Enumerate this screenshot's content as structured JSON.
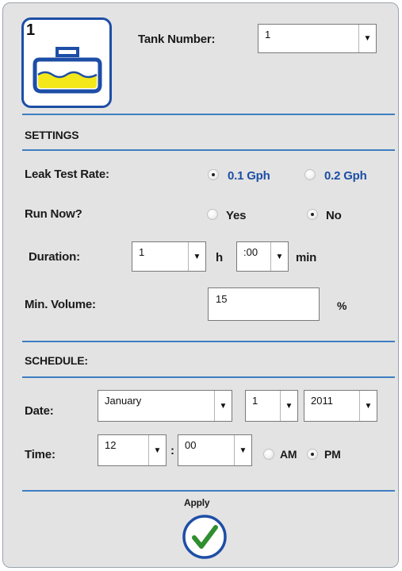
{
  "header": {
    "tank_index": "1",
    "tank_number_label": "Tank Number:",
    "tank_number_value": "1",
    "tank_icon": "tank-icon"
  },
  "settings": {
    "title": "SETTINGS",
    "leak_test_rate_label": "Leak Test Rate:",
    "leak_rate_options": [
      "0.1 Gph",
      "0.2 Gph"
    ],
    "leak_rate_selected": "0.1 Gph",
    "run_now_label": "Run Now?",
    "run_now_options": [
      "Yes",
      "No"
    ],
    "run_now_selected": "No",
    "duration_label": "Duration:",
    "duration_hours": "1",
    "duration_hours_unit": "h",
    "duration_minutes": ":00",
    "duration_minutes_unit": "min",
    "min_volume_label": "Min. Volume:",
    "min_volume_value": "15",
    "min_volume_unit": "%"
  },
  "schedule": {
    "title": "SCHEDULE:",
    "date_label": "Date:",
    "month": "January",
    "day": "1",
    "year": "2011",
    "time_label": "Time:",
    "hour": "12",
    "time_separator": ":",
    "minute": "00",
    "ampm_options": [
      "AM",
      "PM"
    ],
    "ampm_selected": "PM"
  },
  "footer": {
    "apply_label": "Apply",
    "apply_icon": "checkmark-icon"
  },
  "colors": {
    "accent_blue": "#1d4ea6",
    "divider_blue": "#3d7ec2",
    "tank_fill": "#f4e81a",
    "check_green": "#2f8f2f",
    "panel_bg": "#e3e3e3"
  }
}
